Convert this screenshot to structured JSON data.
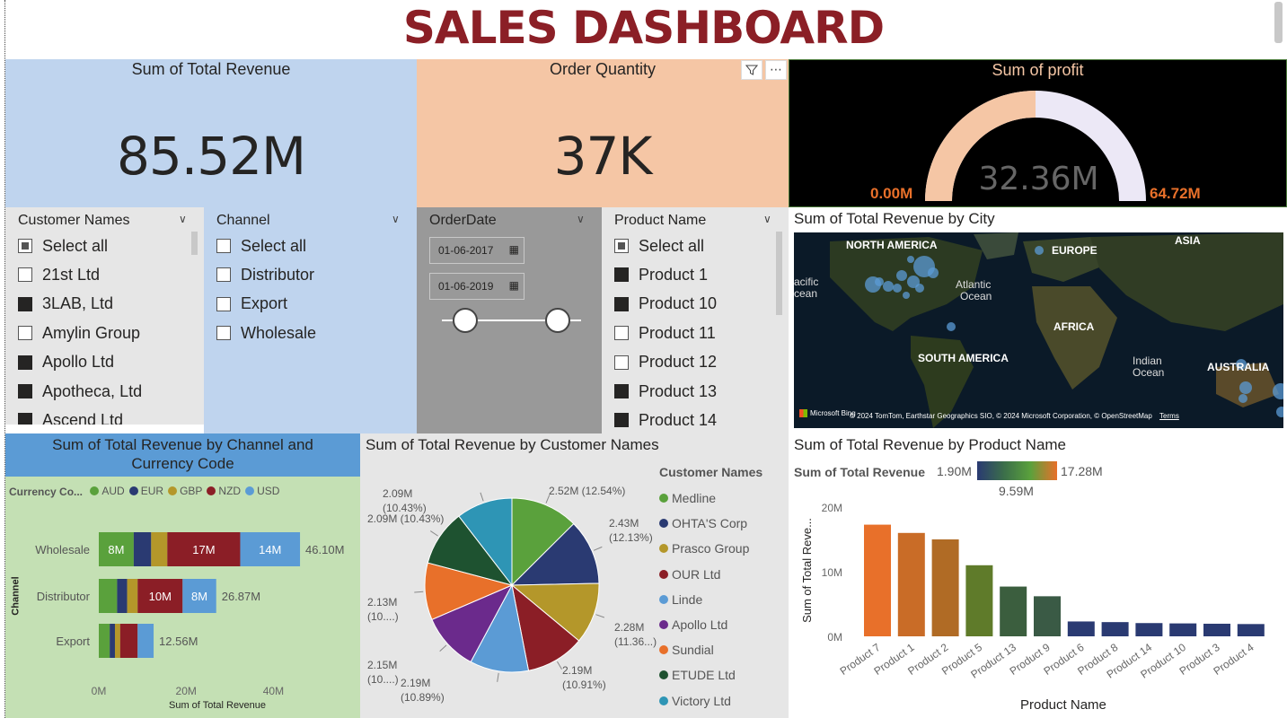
{
  "title": "SALES DASHBOARD",
  "kpis": {
    "revenue": {
      "label": "Sum of Total Revenue",
      "value": "85.52M"
    },
    "quantity": {
      "label": "Order Quantity",
      "value": "37K"
    },
    "profit": {
      "label": "Sum of profit",
      "value": "32.36M",
      "min": "0.00M",
      "max": "64.72M",
      "fraction": 0.5
    }
  },
  "slicers": {
    "customers": {
      "title": "Customer Names",
      "items": [
        {
          "label": "Select all",
          "state": "partial"
        },
        {
          "label": "21st Ltd",
          "state": "off"
        },
        {
          "label": "3LAB, Ltd",
          "state": "on"
        },
        {
          "label": "Amylin Group",
          "state": "off"
        },
        {
          "label": "Apollo Ltd",
          "state": "on"
        },
        {
          "label": "Apotheca, Ltd",
          "state": "on"
        },
        {
          "label": "Ascend Ltd",
          "state": "on"
        }
      ]
    },
    "channel": {
      "title": "Channel",
      "items": [
        {
          "label": "Select all",
          "state": "off"
        },
        {
          "label": "Distributor",
          "state": "off"
        },
        {
          "label": "Export",
          "state": "off"
        },
        {
          "label": "Wholesale",
          "state": "off"
        }
      ]
    },
    "orderdate": {
      "title": "OrderDate",
      "start": "01-06-2017",
      "end": "01-06-2019"
    },
    "products": {
      "title": "Product Name",
      "items": [
        {
          "label": "Select all",
          "state": "partial"
        },
        {
          "label": "Product 1",
          "state": "on"
        },
        {
          "label": "Product 10",
          "state": "on"
        },
        {
          "label": "Product 11",
          "state": "off"
        },
        {
          "label": "Product 12",
          "state": "off"
        },
        {
          "label": "Product 13",
          "state": "on"
        },
        {
          "label": "Product 14",
          "state": "on"
        }
      ]
    }
  },
  "map": {
    "title": "Sum of Total Revenue by City",
    "labels": {
      "north_america": "NORTH AMERICA",
      "europe": "EUROPE",
      "asia": "ASIA",
      "atlantic": "Atlantic",
      "atlantic2": "Ocean",
      "pacific": "acific",
      "pacific2": "cean",
      "africa": "AFRICA",
      "south_america": "SOUTH AMERICA",
      "indian": "Indian",
      "indian2": "Ocean",
      "australia": "AUSTRALIA"
    },
    "logo": "Microsoft Bing",
    "credits": "© 2024 TomTom, Earthstar Geographics SIO, © 2024 Microsoft Corporation, © OpenStreetMap",
    "terms": "Terms"
  },
  "colors": {
    "AUD": "#5aa13c",
    "EUR": "#2a3a72",
    "GBP": "#b4972a",
    "NZD": "#8b1e26",
    "USD": "#5b9bd5",
    "revenue_card": "#bfd4ee",
    "quantity_card": "#f5c6a5",
    "stacked_bg": "#c4e0b4",
    "stacked_title_bg": "#5b9bd5",
    "gauge_fill": "#f5c6a5",
    "gauge_rest": "#ece8f6",
    "gauge_minmax": "#e8702a"
  },
  "stacked": {
    "title_line1": "Sum of Total Revenue by Channel and",
    "title_line2": "Currency Code",
    "legend_title": "Currency Co...",
    "ylabel": "Channel",
    "xlabel": "Sum of Total Revenue",
    "ticks": [
      "0M",
      "20M",
      "40M"
    ]
  },
  "pie": {
    "title": "Sum of Total Revenue by Customer Names",
    "legend_title": "Customer Names"
  },
  "products_chart": {
    "title": "Sum of Total Revenue by Product Name",
    "legend_label": "Sum of Total Revenue",
    "grad_min": "1.90M",
    "grad_mid": "9.59M",
    "grad_max": "17.28M",
    "ylabel": "Sum of Total Reve...",
    "xlabel": "Product Name",
    "ticks": [
      "0M",
      "10M",
      "20M"
    ]
  },
  "chart_data": [
    {
      "type": "bar",
      "orientation": "horizontal-stacked",
      "categories": [
        "Wholesale",
        "Distributor",
        "Export"
      ],
      "series": [
        {
          "name": "AUD",
          "values": [
            8.0,
            4.2,
            2.5
          ]
        },
        {
          "name": "EUR",
          "values": [
            4.0,
            2.3,
            1.2
          ]
        },
        {
          "name": "GBP",
          "values": [
            3.7,
            2.4,
            1.2
          ]
        },
        {
          "name": "NZD",
          "values": [
            16.7,
            10.3,
            4.0
          ]
        },
        {
          "name": "USD",
          "values": [
            13.7,
            7.7,
            3.66
          ]
        }
      ],
      "totals": [
        "46.10M",
        "26.87M",
        "12.56M"
      ],
      "segment_labels": [
        [
          "8M",
          "",
          "",
          "17M",
          "14M"
        ],
        [
          "",
          "",
          "",
          "10M",
          "8M"
        ],
        [
          "",
          "",
          "",
          "",
          ""
        ]
      ],
      "xlim": [
        0,
        50
      ]
    },
    {
      "type": "pie",
      "slices": [
        {
          "name": "Medline",
          "value": 12.54,
          "label": "2.52M (12.54%)",
          "color": "#5aa13c"
        },
        {
          "name": "OHTA'S Corp",
          "value": 12.13,
          "label": "2.43M (12.13%)",
          "color": "#2a3a72"
        },
        {
          "name": "Prasco Group",
          "value": 11.36,
          "label": "2.28M (11.36...)",
          "color": "#b4972a"
        },
        {
          "name": "OUR Ltd",
          "value": 10.91,
          "label": "2.19M (10.91%)",
          "color": "#8b1e26"
        },
        {
          "name": "Linde",
          "value": 10.89,
          "label": "2.19M (10.89%)",
          "color": "#5b9bd5"
        },
        {
          "name": "Apollo Ltd",
          "value": 10.7,
          "label": "2.15M (10....)",
          "color": "#6b2a8c"
        },
        {
          "name": "Sundial",
          "value": 10.6,
          "label": "2.13M (10....)",
          "color": "#e8702a"
        },
        {
          "name": "ETUDE Ltd",
          "value": 10.43,
          "label": "2.09M (10.43%)",
          "color": "#1e5230"
        },
        {
          "name": "Victory Ltd",
          "value": 10.43,
          "label": "2.09M (10.43%)",
          "color": "#2e95b5"
        }
      ]
    },
    {
      "type": "bar",
      "categories": [
        "Product 7",
        "Product 1",
        "Product 2",
        "Product 5",
        "Product 13",
        "Product 9",
        "Product 6",
        "Product 8",
        "Product 14",
        "Product 10",
        "Product 3",
        "Product 4"
      ],
      "values": [
        17.28,
        16.0,
        15.0,
        11.0,
        7.7,
        6.2,
        2.3,
        2.2,
        2.05,
        2.0,
        1.95,
        1.9
      ],
      "colors": [
        "#e8702a",
        "#c96c27",
        "#b06b25",
        "#5f7b2a",
        "#3b5e3e",
        "#3a5a45",
        "#2a3a72",
        "#2a3a72",
        "#2a3a72",
        "#2a3a72",
        "#2a3a72",
        "#2a3a72"
      ],
      "ylim": [
        0,
        20
      ]
    }
  ]
}
